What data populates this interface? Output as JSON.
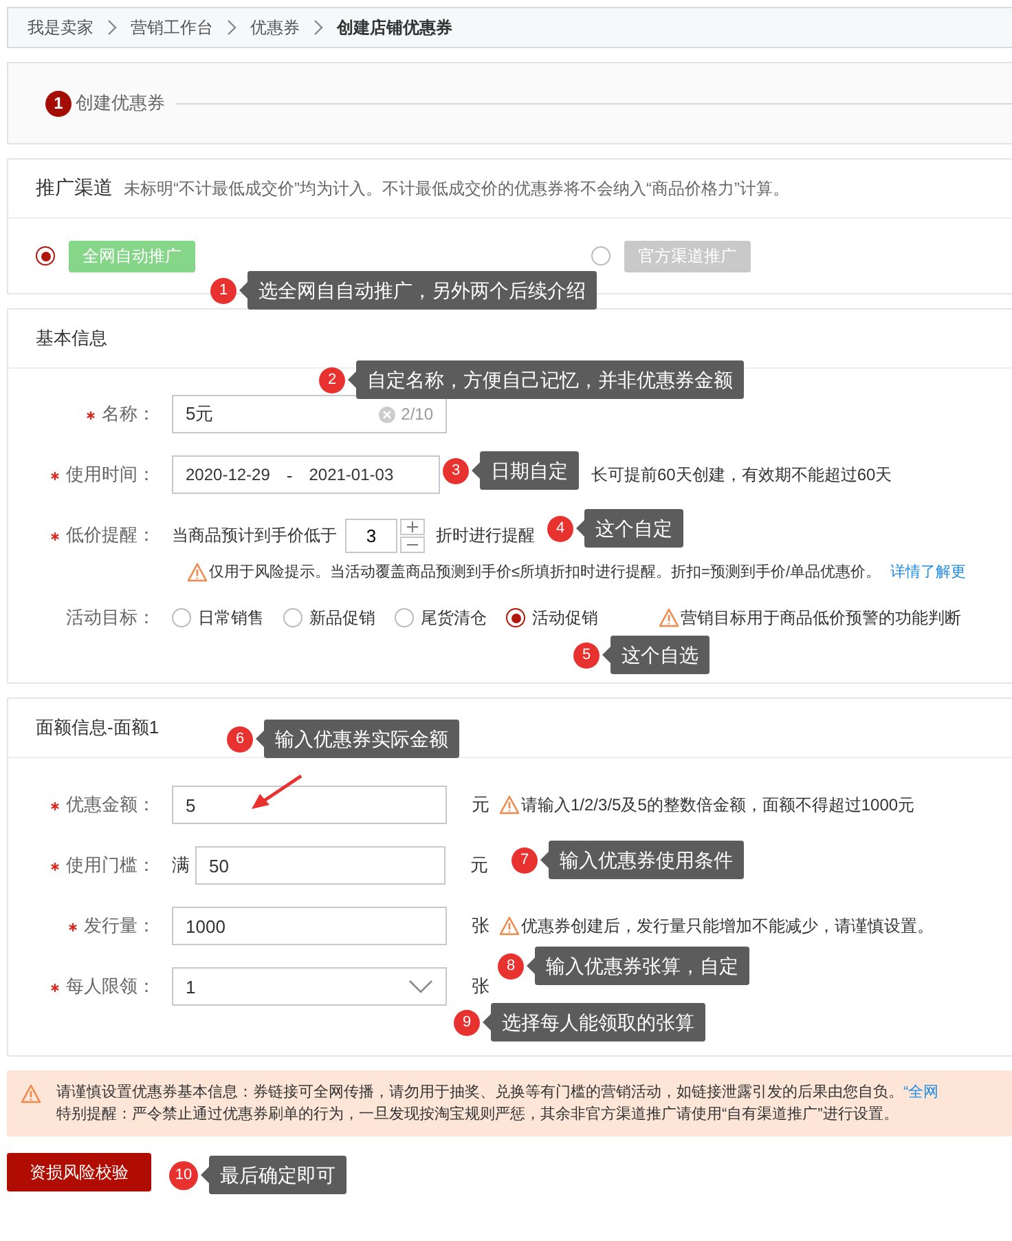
{
  "breadcrumb": [
    {
      "label": "我是卖家",
      "current": false
    },
    {
      "label": "营销工作台",
      "current": false
    },
    {
      "label": "优惠券",
      "current": false
    },
    {
      "label": "创建店铺优惠券",
      "current": true
    }
  ],
  "steps": [
    {
      "number": "1",
      "label": "创建优惠券"
    }
  ],
  "channel": {
    "title": "推广渠道",
    "note": "未标明“不计最低成交价”均为计入。不计最低成交价的优惠券将不会纳入“商品价格力”计算。",
    "options": [
      {
        "label": "全网自动推广",
        "selected": true,
        "disabled": false
      },
      {
        "label": "官方渠道推广",
        "selected": false,
        "disabled": true
      }
    ]
  },
  "basic": {
    "title": "基本信息",
    "fields": [
      {
        "kind": "text",
        "label": "名称：",
        "required": true,
        "value": "5元",
        "counter": "2/10"
      },
      {
        "kind": "daterange",
        "label": "使用时间：",
        "required": true,
        "start": "2020-12-29",
        "separator": "-",
        "end": "2021-01-03",
        "hint": "长可提前60天创建，有效期不能超过60天"
      },
      {
        "kind": "stepper",
        "label": "低价提醒：",
        "required": true,
        "prefix": "当商品预计到手价低于",
        "value": "3",
        "suffix": "折时进行提醒",
        "warning": "仅用于风险提示。当活动覆盖商品预测到手价≤所填折扣时进行提醒。折扣=预测到手价/单品优惠价。",
        "link": "详情了解更"
      },
      {
        "kind": "radios",
        "label": "活动目标：",
        "required": false,
        "options": [
          {
            "label": "日常销售",
            "selected": false
          },
          {
            "label": "新品促销",
            "selected": false
          },
          {
            "label": "尾货清仓",
            "selected": false
          },
          {
            "label": "活动促销",
            "selected": true
          }
        ],
        "warning": "营销目标用于商品低价预警的功能判断"
      }
    ]
  },
  "denomination": {
    "title": "面额信息-面额1",
    "fields": [
      {
        "kind": "text",
        "label": "优惠金额：",
        "required": true,
        "value": "5",
        "unit": "元",
        "warning": "请输入1/2/3/5及5的整数倍金额，面额不得超过1000元"
      },
      {
        "kind": "text",
        "label": "使用门槛：",
        "required": true,
        "prefix": "满",
        "value": "50",
        "unit": "元"
      },
      {
        "kind": "text",
        "label": "发行量：",
        "required": true,
        "value": "1000",
        "unit": "张",
        "warning": "优惠券创建后，发行量只能增加不能减少，请谨慎设置。"
      },
      {
        "kind": "select",
        "label": "每人限领：",
        "required": true,
        "value": "1",
        "unit": "张"
      }
    ]
  },
  "notice": {
    "lines": [
      "请谨慎设置优惠券基本信息：券链接可全网传播，请勿用于抽奖、兑换等有门槛的营销活动，如链接泄露引发的后果由您自负。",
      "特别提醒：严令禁止通过优惠券刷单的行为，一旦发现按淘宝规则严惩，其余非官方渠道推广请使用“自有渠道推广”进行设置。"
    ],
    "link": "“全网"
  },
  "submit_button": "资损风险校验",
  "callouts": [
    {
      "number": "1",
      "text": "选全网自自动推广，另外两个后续介绍"
    },
    {
      "number": "2",
      "text": "自定名称，方便自己记忆，并非优惠券金额"
    },
    {
      "number": "3",
      "text": "日期自定"
    },
    {
      "number": "4",
      "text": "这个自定"
    },
    {
      "number": "5",
      "text": "这个自选"
    },
    {
      "number": "6",
      "text": "输入优惠券实际金额"
    },
    {
      "number": "7",
      "text": "输入优惠券使用条件"
    },
    {
      "number": "8",
      "text": "输入优惠券张算，自定"
    },
    {
      "number": "9",
      "text": "选择每人能领取的张算"
    },
    {
      "number": "10",
      "text": "最后确定即可"
    }
  ]
}
